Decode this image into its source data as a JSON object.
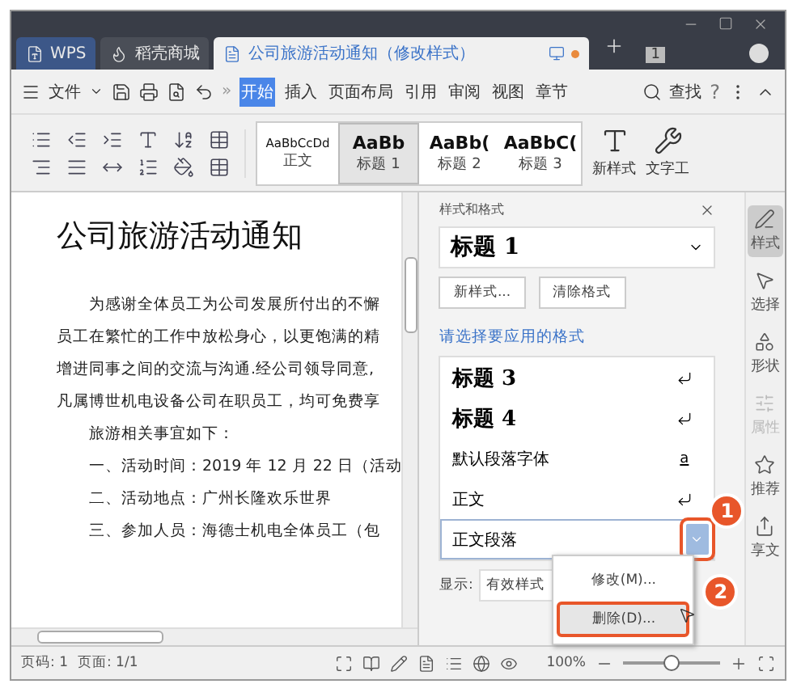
{
  "tabs": [
    {
      "label": "WPS",
      "kind": "home",
      "selected": false
    },
    {
      "label": "稻壳商城",
      "kind": "store",
      "selected": false
    },
    {
      "label": "公司旅游活动通知（修改样式）",
      "kind": "doc",
      "selected": true
    }
  ],
  "tab_counter": "1",
  "menu": {
    "file": "文件",
    "more": "»",
    "tabs": [
      {
        "label": "开始",
        "selected": true
      },
      {
        "label": "插入",
        "selected": false
      },
      {
        "label": "页面布局",
        "selected": false
      },
      {
        "label": "引用",
        "selected": false
      },
      {
        "label": "审阅",
        "selected": false
      },
      {
        "label": "视图",
        "selected": false
      },
      {
        "label": "章节",
        "selected": false
      }
    ],
    "search": "查找",
    "help": "?"
  },
  "gallery": [
    {
      "preview": "AaBbCcDd",
      "name": "正文",
      "kind": "body",
      "selected": false
    },
    {
      "preview": "AaBb",
      "name": "标题 1",
      "kind": "heading",
      "selected": true
    },
    {
      "preview": "AaBb(",
      "name": "标题 2",
      "kind": "heading",
      "selected": false
    },
    {
      "preview": "AaBbC(",
      "name": "标题 3",
      "kind": "heading",
      "selected": false
    }
  ],
  "new_style": "新样式",
  "text_tools": "文字工",
  "document": {
    "title": "公司旅游活动通知",
    "paragraphs": [
      {
        "text": "为感谢全体员工为公司发展所付出的不懈",
        "indented": true
      },
      {
        "text": "员工在繁忙的工作中放松身心，以更饱满的精",
        "indented": false
      },
      {
        "text": "增进同事之间的交流与沟通.经公司领导同意,",
        "indented": false
      },
      {
        "text": "凡属博世机电设备公司在职员工，均可免费享",
        "indented": false
      },
      {
        "text": "旅游相关事宜如下：",
        "indented": true
      },
      {
        "text": "一、活动时间：2019 年 12 月 22 日（活动",
        "indented": true
      },
      {
        "text": "二、活动地点：广州长隆欢乐世界",
        "indented": true
      },
      {
        "text": "三、参加人员：海德士机电全体员工（包",
        "indented": true
      }
    ]
  },
  "panel": {
    "title": "样式和格式",
    "current_style": "标题 1",
    "buttons": [
      "新样式...",
      "清除格式"
    ],
    "prompt": "请选择要应用的格式",
    "styles": [
      {
        "label": "标题 3",
        "kind": "heading",
        "selected": false
      },
      {
        "label": "标题 4",
        "kind": "heading",
        "selected": false
      },
      {
        "label": "默认段落字体",
        "kind": "character",
        "mark": "a",
        "selected": false
      },
      {
        "label": "正文",
        "kind": "paragraph",
        "selected": false
      },
      {
        "label": "正文段落",
        "kind": "paragraph",
        "selected": true
      }
    ],
    "show_label": "显示:",
    "show_value": "有效样式",
    "menu": [
      {
        "label": "修改(M)...",
        "highlighted": false
      },
      {
        "label": "删除(D)...",
        "highlighted": true
      }
    ],
    "callouts": [
      "1",
      "2"
    ]
  },
  "sidebar": [
    {
      "label": "样式",
      "selected": true,
      "disabled": false
    },
    {
      "label": "选择",
      "selected": false,
      "disabled": false
    },
    {
      "label": "形状",
      "selected": false,
      "disabled": false
    },
    {
      "label": "属性",
      "selected": false,
      "disabled": true
    },
    {
      "label": "推荐",
      "selected": false,
      "disabled": false
    },
    {
      "label": "享文",
      "selected": false,
      "disabled": false
    }
  ],
  "status_bar": {
    "page": "页码: 1",
    "pages": "页面: 1/1",
    "zoom": "100%",
    "zoom_slider": {
      "level": 0.5
    }
  }
}
